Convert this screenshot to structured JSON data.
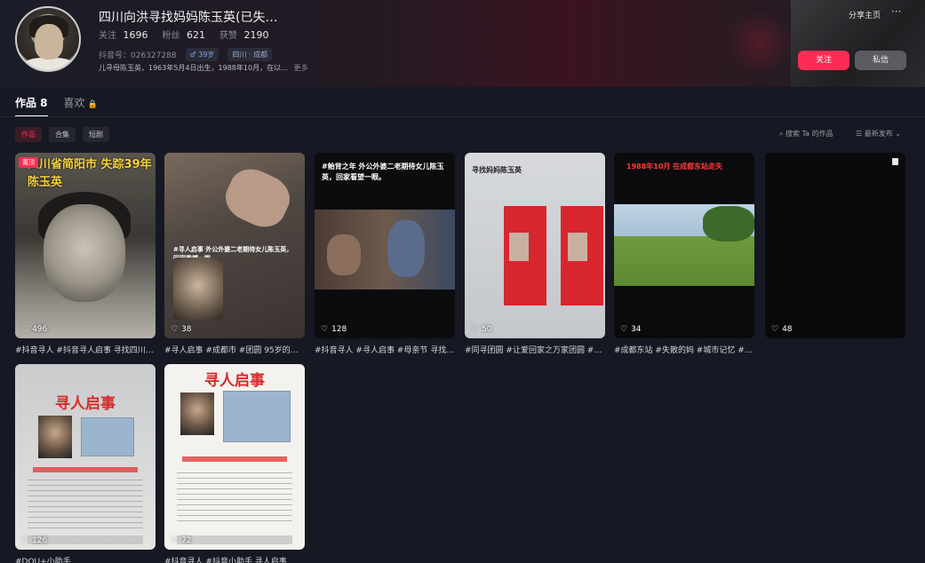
{
  "profile": {
    "name": "四川向洪寻找妈妈陈玉英(已失…",
    "stats": [
      {
        "label": "关注",
        "value": "1696"
      },
      {
        "label": "粉丝",
        "value": "621"
      },
      {
        "label": "获赞",
        "value": "2190"
      }
    ],
    "id_text": "抖音号：026327288",
    "tags": [
      "♂ 39岁",
      "四川 · 成都"
    ],
    "bio": "儿寻母陈玉英，1963年5月4日出生，1988年10月，在以…",
    "bio_more": "更多"
  },
  "header_actions": {
    "share": "分享主页",
    "more": "···",
    "follow": "关注",
    "message": "私信"
  },
  "tabs": [
    {
      "label": "作品 8"
    },
    {
      "label": "喜欢",
      "icon": "lock-icon"
    }
  ],
  "filters": [
    "作品",
    "合集",
    "短剧"
  ],
  "search_works": "⌕ 搜索 Ta 的作品",
  "sort": "☰ 最新发布 ⌄",
  "videos": [
    {
      "likes": "496",
      "caption": "#抖音寻人 #抖音寻人启事 寻找四川…",
      "overlay": "四川省简阳市 失踪39年陈玉英",
      "badge": "置顶"
    },
    {
      "likes": "38",
      "caption": "#寻人启事 #成都市 #团圆 95岁的外…",
      "overlay": "#寻人启事 外公外婆二老期待女儿陈玉英，回家看望一眼"
    },
    {
      "likes": "128",
      "caption": "#抖音寻人 #寻人启事 #母亲节 寻找…",
      "overlay": "#鲐背之年 外公外婆二老期待女儿陈玉英，回家看望一眼。"
    },
    {
      "likes": "50",
      "caption": "#同寻团圆 #让爱回家之万家团圆 #…",
      "overlay": "寻找妈妈陈玉英"
    },
    {
      "likes": "34",
      "caption": "#成都东站 #失散的妈 #城市记忆 #…",
      "overlay": "1988年10月 在成都东站走失"
    },
    {
      "likes": "48",
      "caption": "",
      "overlay": ""
    },
    {
      "likes": "126",
      "caption": "#DOU+小助手",
      "notice_title": "寻人启事"
    },
    {
      "likes": "72",
      "caption": "#抖音寻人 #抖音小助手 寻人启事",
      "notice_title": "寻人启事"
    }
  ],
  "colors": {
    "accent": "#fe2c55",
    "background": "#161823"
  }
}
